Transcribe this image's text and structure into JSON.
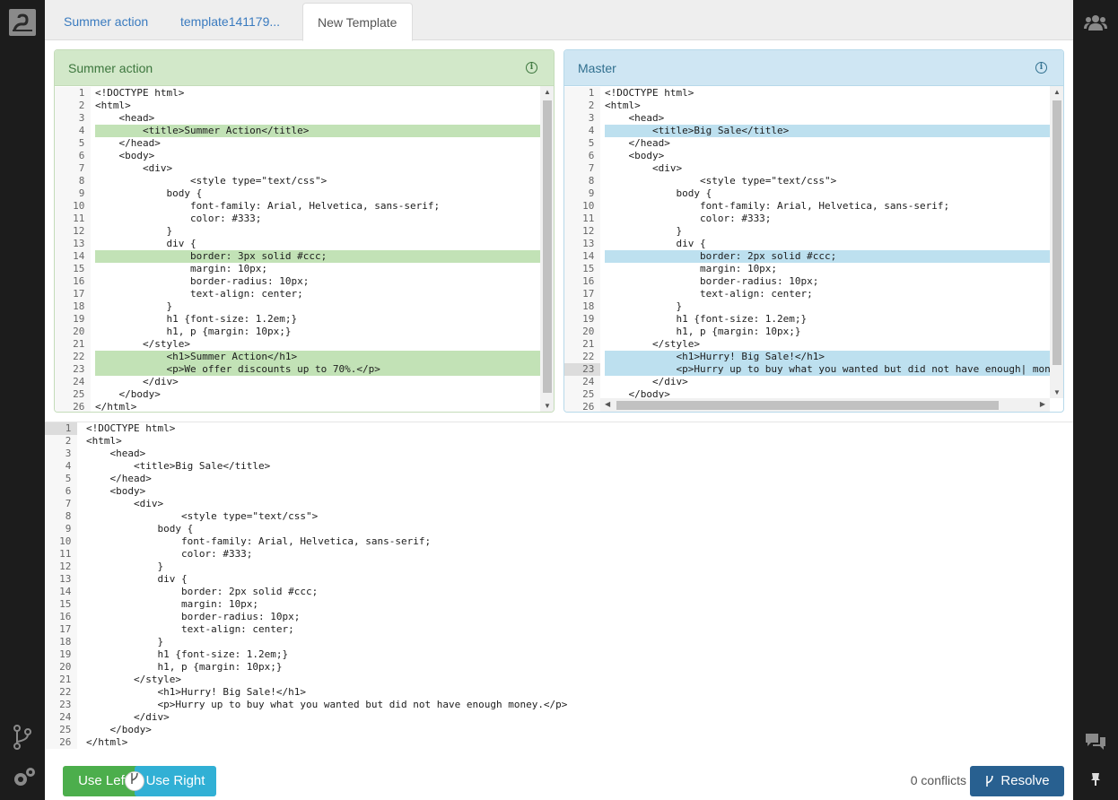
{
  "tabs": [
    {
      "label": "Summer action"
    },
    {
      "label": "template141179..."
    },
    {
      "label": "New Template"
    }
  ],
  "left_panel": {
    "title": "Summer action"
  },
  "right_panel": {
    "title": "Master"
  },
  "footer": {
    "use_left": "Use Left",
    "use_right": "Use Right",
    "conflicts": "0 conflicts",
    "resolve": "Resolve"
  },
  "left_code": [
    "<!DOCTYPE html>",
    "<html>",
    "    <head>",
    "        <title>Summer Action</title>",
    "    </head>",
    "    <body>",
    "        <div>",
    "                <style type=\"text/css\">",
    "            body {",
    "                font-family: Arial, Helvetica, sans-serif;",
    "                color: #333;",
    "            }",
    "            div {",
    "                border: 3px solid #ccc;",
    "                margin: 10px;",
    "                border-radius: 10px;",
    "                text-align: center;",
    "            }",
    "            h1 {font-size: 1.2em;}",
    "            h1, p {margin: 10px;}",
    "        </style>",
    "            <h1>Summer Action</h1>",
    "            <p>We offer discounts up to 70%.</p>",
    "        </div>",
    "    </body>",
    "</html>"
  ],
  "right_code": [
    "<!DOCTYPE html>",
    "<html>",
    "    <head>",
    "        <title>Big Sale</title>",
    "    </head>",
    "    <body>",
    "        <div>",
    "                <style type=\"text/css\">",
    "            body {",
    "                font-family: Arial, Helvetica, sans-serif;",
    "                color: #333;",
    "            }",
    "            div {",
    "                border: 2px solid #ccc;",
    "                margin: 10px;",
    "                border-radius: 10px;",
    "                text-align: center;",
    "            }",
    "            h1 {font-size: 1.2em;}",
    "            h1, p {margin: 10px;}",
    "        </style>",
    "            <h1>Hurry! Big Sale!</h1>",
    "            <p>Hurry up to buy what you wanted but did not have enough| mone",
    "        </div>",
    "    </body>",
    ""
  ],
  "bottom_code": [
    "<!DOCTYPE html>",
    "<html>",
    "    <head>",
    "        <title>Big Sale</title>",
    "    </head>",
    "    <body>",
    "        <div>",
    "                <style type=\"text/css\">",
    "            body {",
    "                font-family: Arial, Helvetica, sans-serif;",
    "                color: #333;",
    "            }",
    "            div {",
    "                border: 2px solid #ccc;",
    "                margin: 10px;",
    "                border-radius: 10px;",
    "                text-align: center;",
    "            }",
    "            h1 {font-size: 1.2em;}",
    "            h1, p {margin: 10px;}",
    "        </style>",
    "            <h1>Hurry! Big Sale!</h1>",
    "            <p>Hurry up to buy what you wanted but did not have enough money.</p>",
    "        </div>",
    "    </body>",
    "</html>"
  ],
  "left_highlight": [
    4,
    14,
    22,
    23
  ],
  "right_highlight": [
    4,
    14,
    22,
    23
  ],
  "right_current_line": 23,
  "bottom_current_line": 1,
  "icons": {
    "logo": "swan-logo-icon",
    "branch": "branch-icon",
    "settings": "gear-icon",
    "users": "users-icon",
    "chat": "chat-icon",
    "pin": "pin-icon",
    "info": "info-icon",
    "merge": "merge-icon"
  },
  "colors": {
    "left_accent": "#d2e8c9",
    "right_accent": "#cfe6f3",
    "use_left_btn": "#4cae4c",
    "use_right_btn": "#31b0d5",
    "resolve_btn": "#286090"
  }
}
